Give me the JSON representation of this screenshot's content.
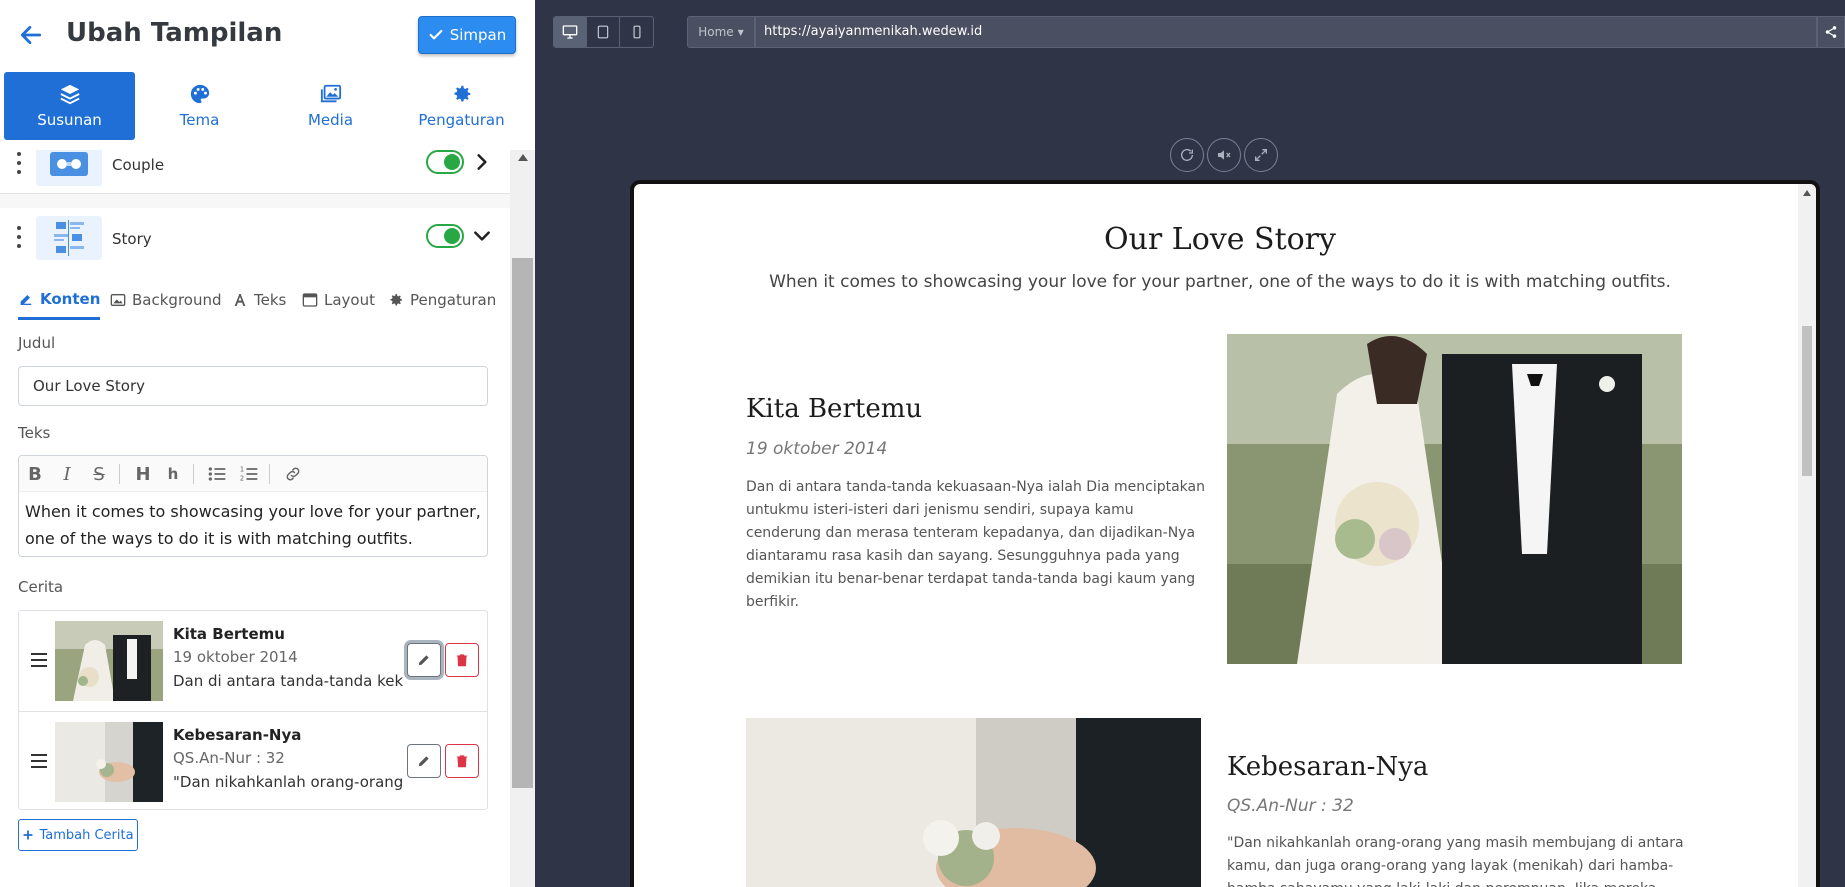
{
  "header": {
    "title": "Ubah Tampilan",
    "save_label": "Simpan"
  },
  "main_tabs": [
    {
      "label": "Susunan",
      "icon": "layers-icon",
      "active": true
    },
    {
      "label": "Tema",
      "icon": "palette-icon",
      "active": false
    },
    {
      "label": "Media",
      "icon": "images-icon",
      "active": false
    },
    {
      "label": "Pengaturan",
      "icon": "gear-icon",
      "active": false
    }
  ],
  "sections": [
    {
      "label": "Couple",
      "enabled": true,
      "expanded": false
    },
    {
      "label": "Story",
      "enabled": true,
      "expanded": true
    }
  ],
  "sub_tabs": [
    {
      "label": "Konten",
      "icon": "edit-icon",
      "active": true
    },
    {
      "label": "Background",
      "icon": "image-icon",
      "active": false
    },
    {
      "label": "Teks",
      "icon": "font-icon",
      "active": false
    },
    {
      "label": "Layout",
      "icon": "window-icon",
      "active": false
    },
    {
      "label": "Pengaturan",
      "icon": "gear-icon",
      "active": false
    }
  ],
  "form": {
    "title_label": "Judul",
    "title_value": "Our Love Story",
    "text_label": "Teks",
    "text_value": "When it comes to showcasing your love for your partner, one of the ways to do it is with matching outfits.",
    "stories_label": "Cerita",
    "add_story_label": "Tambah Cerita"
  },
  "stories": [
    {
      "title": "Kita Bertemu",
      "date": "19 oktober 2014",
      "excerpt": "Dan di antara tanda-tanda kekuasaan-Nya ialah Dia menciptakan"
    },
    {
      "title": "Kebesaran-Nya",
      "date": "QS.An-Nur : 32",
      "excerpt": "\"Dan nikahkanlah orang-orang yang masih membujang di antara"
    }
  ],
  "preview": {
    "page_select": "Home",
    "url": "https://ayaiyanmenikah.wedew.id",
    "heading": "Our Love Story",
    "subheading": "When it comes to showcasing your love for your partner, one of the ways to do it is with matching outfits.",
    "story1": {
      "title": "Kita Bertemu",
      "date": "19 oktober 2014",
      "body": "Dan di antara tanda-tanda kekuasaan-Nya ialah Dia menciptakan untukmu isteri-isteri dari jenismu sendiri, supaya kamu cenderung dan merasa tenteram kepadanya, dan dijadikan-Nya diantaramu rasa kasih dan sayang. Sesungguhnya pada yang demikian itu benar-benar terdapat tanda-tanda bagi kaum yang berfikir."
    },
    "story2": {
      "title": "Kebesaran-Nya",
      "date": "QS.An-Nur : 32",
      "body": "\"Dan nikahkanlah orang-orang yang masih membujang di antara kamu, dan juga orang-orang yang layak (menikah) dari hamba-hamba sahayamu yang laki-laki dan perempuan. Jika mereka"
    }
  },
  "colors": {
    "primary": "#1f6fd6",
    "save_button": "#2d8cf0",
    "toggle_on": "#28a745",
    "danger": "#dc3545",
    "workspace_bg": "#2f3547"
  }
}
